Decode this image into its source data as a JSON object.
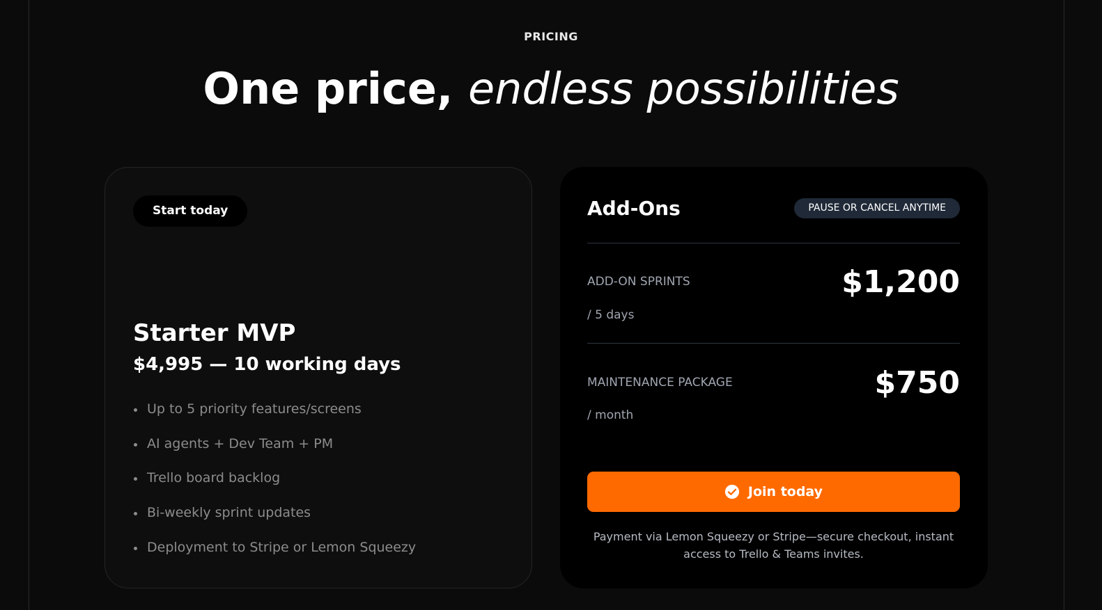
{
  "header": {
    "eyebrow": "PRICING",
    "headline_strong": "One price,",
    "headline_italic": "endless possibilities"
  },
  "plan": {
    "pill_label": "Start today",
    "title": "Starter MVP",
    "price_line": "$4,995 — 10 working days",
    "features": [
      "Up to 5 priority features/screens",
      "AI agents + Dev Team + PM",
      "Trello board backlog",
      "Bi-weekly sprint updates",
      "Deployment to Stripe or Lemon Squeezy"
    ]
  },
  "addons": {
    "title": "Add-Ons",
    "badge": "PAUSE OR CANCEL ANYTIME",
    "items": [
      {
        "label": "ADD-ON SPRINTS",
        "unit": "/ 5 days",
        "price": "$1,200"
      },
      {
        "label": "MAINTENANCE PACKAGE",
        "unit": "/ month",
        "price": "$750"
      }
    ],
    "cta_label": "Join today",
    "footnote": "Payment via Lemon Squeezy or Stripe—secure checkout, instant access to Trello & Teams invites."
  },
  "colors": {
    "accent": "#ff6a00",
    "badge_bg": "#1f2937",
    "muted_text": "#8c8c8c"
  }
}
